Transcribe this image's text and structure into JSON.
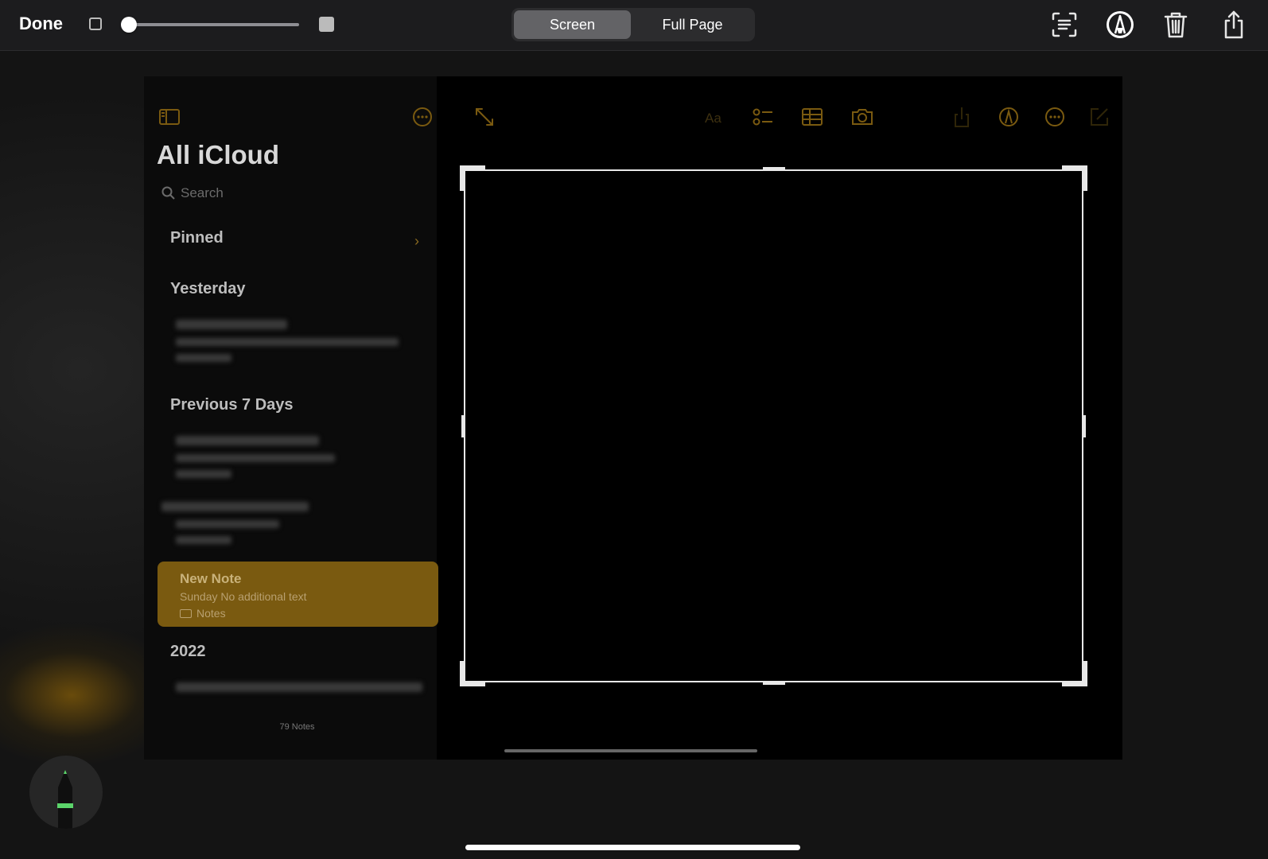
{
  "toolbar": {
    "done_label": "Done",
    "segments": [
      "Screen",
      "Full Page"
    ],
    "active_segment": "Screen",
    "pen_size_level": 0.0
  },
  "screenshot": {
    "sidebar_title": "All iCloud",
    "search_placeholder": "Search",
    "sections": {
      "pinned": "Pinned",
      "yesterday": "Yesterday",
      "previous": "Previous 7 Days",
      "year": "2022"
    },
    "selected_note": {
      "title": "New Note",
      "subtitle": "Sunday  No additional text",
      "folder": "Notes"
    },
    "notes_count": "79 Notes"
  },
  "colors": {
    "accent": "#7a5a10",
    "text_dim": "#bdbdbd"
  },
  "icons": [
    "sidebar-icon",
    "ellipsis-circle-icon",
    "expand-icon",
    "text-format-icon",
    "checklist-icon",
    "table-icon",
    "camera-icon",
    "share-icon",
    "markup-icon",
    "compose-icon",
    "text-recognition-icon",
    "trash-icon",
    "pencil-icon"
  ]
}
